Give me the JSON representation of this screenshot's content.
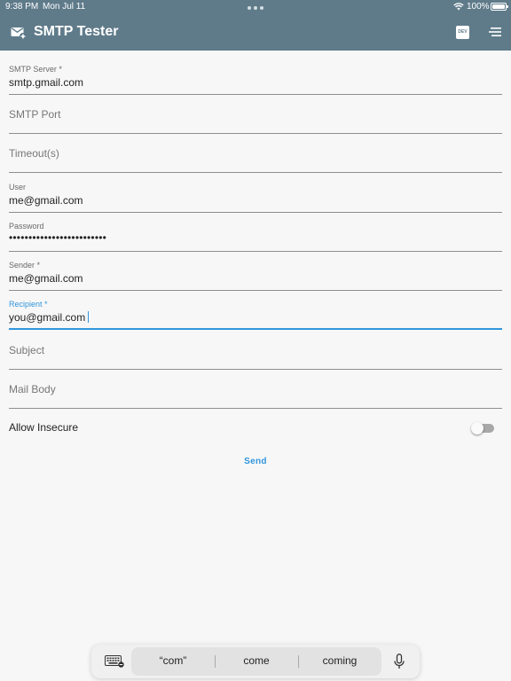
{
  "status_bar": {
    "time": "9:38 PM",
    "date": "Mon Jul 11",
    "battery": "100%",
    "icons": [
      "multitask-dots-icon",
      "wifi-icon",
      "battery-icon"
    ]
  },
  "app_bar": {
    "title": "SMTP Tester",
    "leading_icon": "mail-add-icon",
    "actions": [
      {
        "name": "dev-icon",
        "label": "DEV"
      },
      {
        "name": "sort-menu-icon"
      }
    ],
    "color": "#5f7b8a"
  },
  "form": {
    "smtp_server": {
      "label": "SMTP Server *",
      "value": "smtp.gmail.com"
    },
    "smtp_port": {
      "placeholder": "SMTP Port"
    },
    "timeout": {
      "placeholder": "Timeout(s)"
    },
    "user": {
      "label": "User",
      "value": "me@gmail.com"
    },
    "password": {
      "label": "Password",
      "value": "•••••••••••••••••••••••••"
    },
    "sender": {
      "label": "Sender *",
      "value": "me@gmail.com"
    },
    "recipient": {
      "label": "Recipient *",
      "value": "you@gmail.com",
      "focused": true
    },
    "subject": {
      "placeholder": "Subject"
    },
    "mail_body": {
      "placeholder": "Mail Body"
    },
    "allow_insecure": {
      "label": "Allow Insecure",
      "enabled": false
    },
    "send_label": "Send",
    "accent_color": "#3196dc"
  },
  "keyboard_bar": {
    "suggestions": [
      "“com”",
      "come",
      "coming"
    ],
    "icons": [
      "keyboard-icon",
      "microphone-icon"
    ]
  }
}
